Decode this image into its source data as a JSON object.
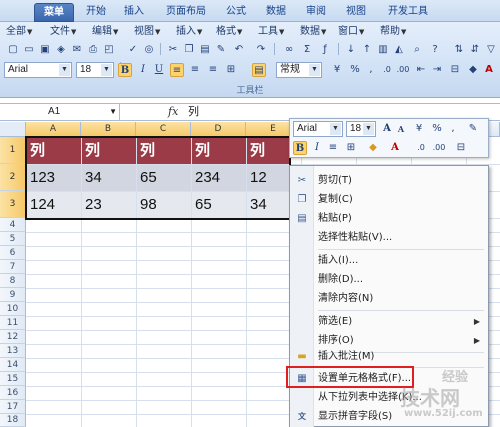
{
  "tabs": [
    {
      "label": "菜单",
      "active": true
    },
    {
      "label": "开始",
      "active": false
    },
    {
      "label": "插入",
      "active": false
    },
    {
      "label": "页面布局",
      "active": false
    },
    {
      "label": "公式",
      "active": false
    },
    {
      "label": "数据",
      "active": false
    },
    {
      "label": "审阅",
      "active": false
    },
    {
      "label": "视图",
      "active": false
    },
    {
      "label": "开发工具",
      "active": false
    }
  ],
  "menus": [
    "全部",
    "文件",
    "编辑",
    "视图",
    "插入",
    "格式",
    "工具",
    "数据",
    "窗口",
    "帮助"
  ],
  "toolbar": {
    "font_name": "Arial",
    "font_size": "18",
    "number_format": "常规",
    "group_label": "工具栏"
  },
  "formula_bar": {
    "name_box": "A1",
    "fx_label": "fx",
    "value": "列"
  },
  "columns": [
    "A",
    "B",
    "C",
    "D",
    "E"
  ],
  "rows": [
    "1",
    "2",
    "3",
    "4",
    "5",
    "6",
    "7",
    "8",
    "9",
    "10",
    "11",
    "12",
    "13",
    "14",
    "15",
    "16",
    "17",
    "18"
  ],
  "cells": [
    [
      "列",
      "列",
      "列",
      "列",
      "列"
    ],
    [
      "123",
      "34",
      "65",
      "234",
      "12"
    ],
    [
      "124",
      "23",
      "98",
      "65",
      "34"
    ]
  ],
  "mini_toolbar": {
    "font_name": "Arial",
    "font_size": "18"
  },
  "context_menu": [
    {
      "label": "剪切(T)",
      "icon": "scissors-icon"
    },
    {
      "label": "复制(C)",
      "icon": "copy-icon"
    },
    {
      "label": "粘贴(P)",
      "icon": "paste-icon"
    },
    {
      "label": "选择性粘贴(V)...",
      "icon": ""
    },
    {
      "label": "插入(I)...",
      "icon": ""
    },
    {
      "label": "删除(D)...",
      "icon": ""
    },
    {
      "label": "清除内容(N)",
      "icon": ""
    },
    {
      "label": "筛选(E)",
      "icon": "",
      "submenu": true
    },
    {
      "label": "排序(O)",
      "icon": "",
      "submenu": true
    },
    {
      "label": "插入批注(M)",
      "icon": "comment-icon"
    },
    {
      "label": "设置单元格格式(F)...",
      "icon": "format-cells-icon",
      "highlighted": true
    },
    {
      "label": "从下拉列表中选择(K)...",
      "icon": ""
    },
    {
      "label": "显示拼音字段(S)",
      "icon": "phonetic-icon"
    }
  ],
  "watermark": {
    "line1": "技术网",
    "line2": "www.52ij.com",
    "line3": "经验"
  },
  "colors": {
    "header_fill": "#9b3b47",
    "row2_fill": "#d2d6e0",
    "row3_fill": "#e6e8ef",
    "highlight_box": "#e02020"
  }
}
